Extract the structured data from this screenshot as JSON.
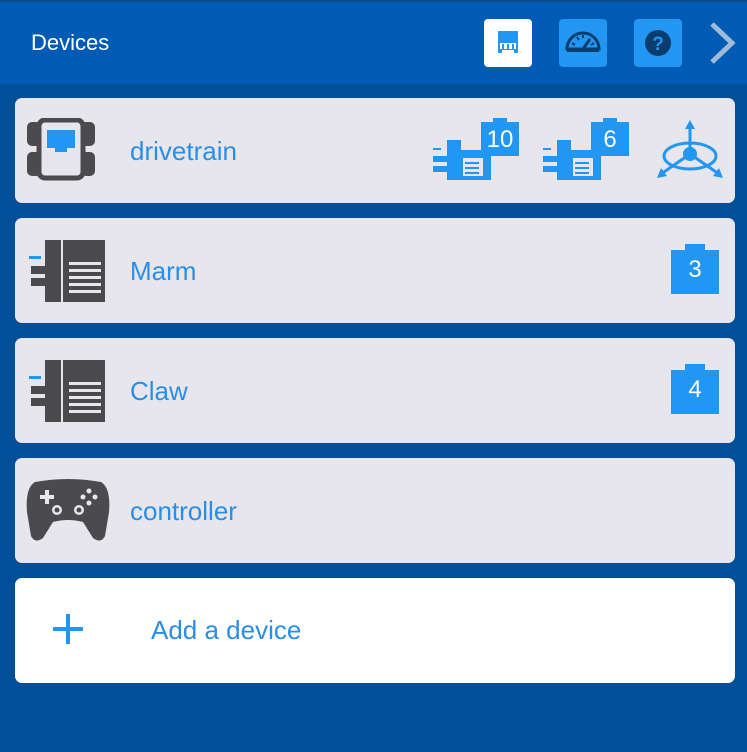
{
  "header": {
    "title": "Devices",
    "buttons": [
      {
        "icon": "brain-port-icon",
        "active": true
      },
      {
        "icon": "dashboard-icon",
        "active": false
      },
      {
        "icon": "help-icon",
        "active": false
      },
      {
        "icon": "chevron-right-icon",
        "active": false
      }
    ]
  },
  "devices": [
    {
      "label": "drivetrain",
      "icon": "drivetrain-icon",
      "ports": [
        "10",
        "6"
      ],
      "extra_icon": "gyro-icon"
    },
    {
      "label": "Marm",
      "icon": "motor-icon",
      "ports": [
        "3"
      ]
    },
    {
      "label": "Claw",
      "icon": "motor-icon",
      "ports": [
        "4"
      ]
    },
    {
      "label": "controller",
      "icon": "controller-icon",
      "ports": []
    }
  ],
  "add_device": {
    "label": "Add a device",
    "icon": "plus-icon"
  },
  "colors": {
    "background": "#004f98",
    "header": "#005bb5",
    "accent": "#2196f3",
    "card": "#e6e6ec",
    "text_accent": "#2b8ee6",
    "icon_dark": "#4a4a4f"
  }
}
